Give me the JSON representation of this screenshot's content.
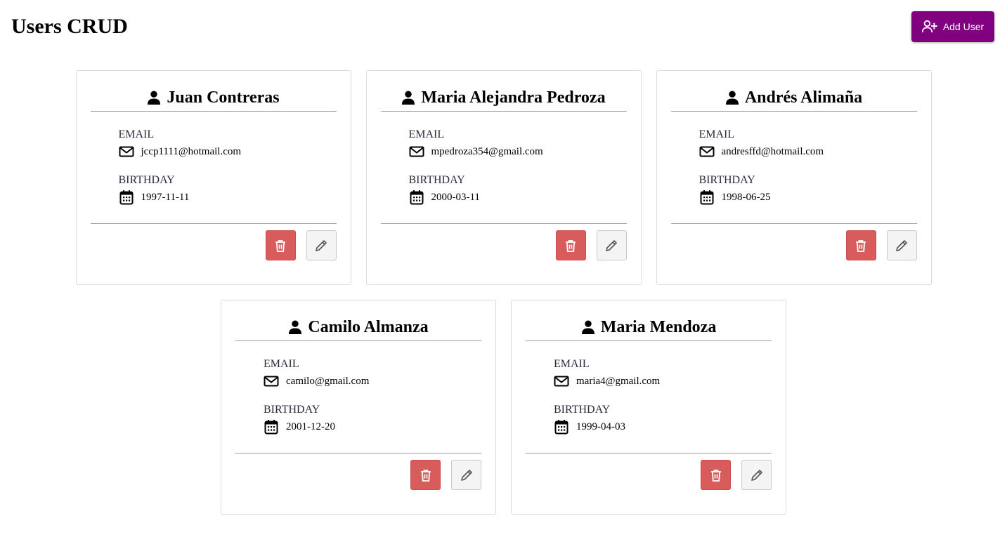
{
  "header": {
    "title": "Users CRUD",
    "add_user_label": "Add User"
  },
  "labels": {
    "email": "EMAIL",
    "birthday": "BIRTHDAY"
  },
  "colors": {
    "accent": "#800080",
    "delete": "#d95c5c",
    "edit": "#f4f4f4"
  },
  "users": [
    {
      "name": "Juan Contreras",
      "email": "jccp1111@hotmail.com",
      "birthday": "1997-11-11"
    },
    {
      "name": "Maria Alejandra Pedroza",
      "email": "mpedroza354@gmail.com",
      "birthday": "2000-03-11"
    },
    {
      "name": "Andrés Alimaña",
      "email": "andresffd@hotmail.com",
      "birthday": "1998-06-25"
    },
    {
      "name": "Camilo Almanza",
      "email": "camilo@gmail.com",
      "birthday": "2001-12-20"
    },
    {
      "name": "Maria Mendoza",
      "email": "maria4@gmail.com",
      "birthday": "1999-04-03"
    }
  ]
}
